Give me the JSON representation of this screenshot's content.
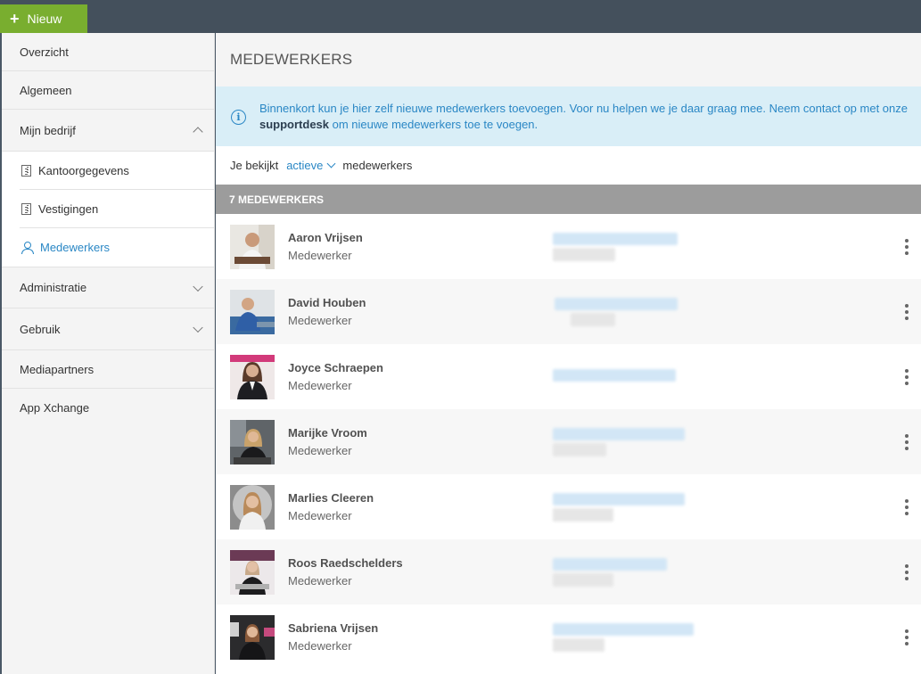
{
  "topbar": {
    "new_label": "Nieuw"
  },
  "sidebar": {
    "items": [
      {
        "label": "Overzicht"
      },
      {
        "label": "Algemeen"
      },
      {
        "label": "Mijn bedrijf"
      },
      {
        "label": "Administratie"
      },
      {
        "label": "Gebruik"
      },
      {
        "label": "Mediapartners"
      },
      {
        "label": "App Xchange"
      }
    ],
    "sub_items": [
      {
        "label": "Kantoorgegevens",
        "icon": "building-icon"
      },
      {
        "label": "Vestigingen",
        "icon": "building-icon"
      },
      {
        "label": "Medewerkers",
        "icon": "user-icon"
      }
    ]
  },
  "main": {
    "title": "MEDEWERKERS",
    "info": {
      "text_before": "Binnenkort kun je hier zelf nieuwe medewerkers toevoegen. Voor nu helpen we je daar graag mee. Neem contact op met onze ",
      "link": "supportdesk",
      "text_after": " om nieuwe medewerkers toe te voegen."
    },
    "filter": {
      "prefix": "Je bekijkt",
      "selected": "actieve",
      "suffix": "medewerkers"
    },
    "count_label": "7 MEDEWERKERS",
    "employees": [
      {
        "name": "Aaron Vrijsen",
        "role": "Medewerker"
      },
      {
        "name": "David Houben",
        "role": "Medewerker"
      },
      {
        "name": "Joyce Schraepen",
        "role": "Medewerker"
      },
      {
        "name": "Marijke Vroom",
        "role": "Medewerker"
      },
      {
        "name": "Marlies Cleeren",
        "role": "Medewerker"
      },
      {
        "name": "Roos Raedschelders",
        "role": "Medewerker"
      },
      {
        "name": "Sabriena Vrijsen",
        "role": "Medewerker"
      }
    ]
  },
  "colors": {
    "accent": "#2a87c5",
    "new_button": "#79ae2f",
    "info_bg": "#d9eef7",
    "count_bar": "#9c9c9c"
  }
}
